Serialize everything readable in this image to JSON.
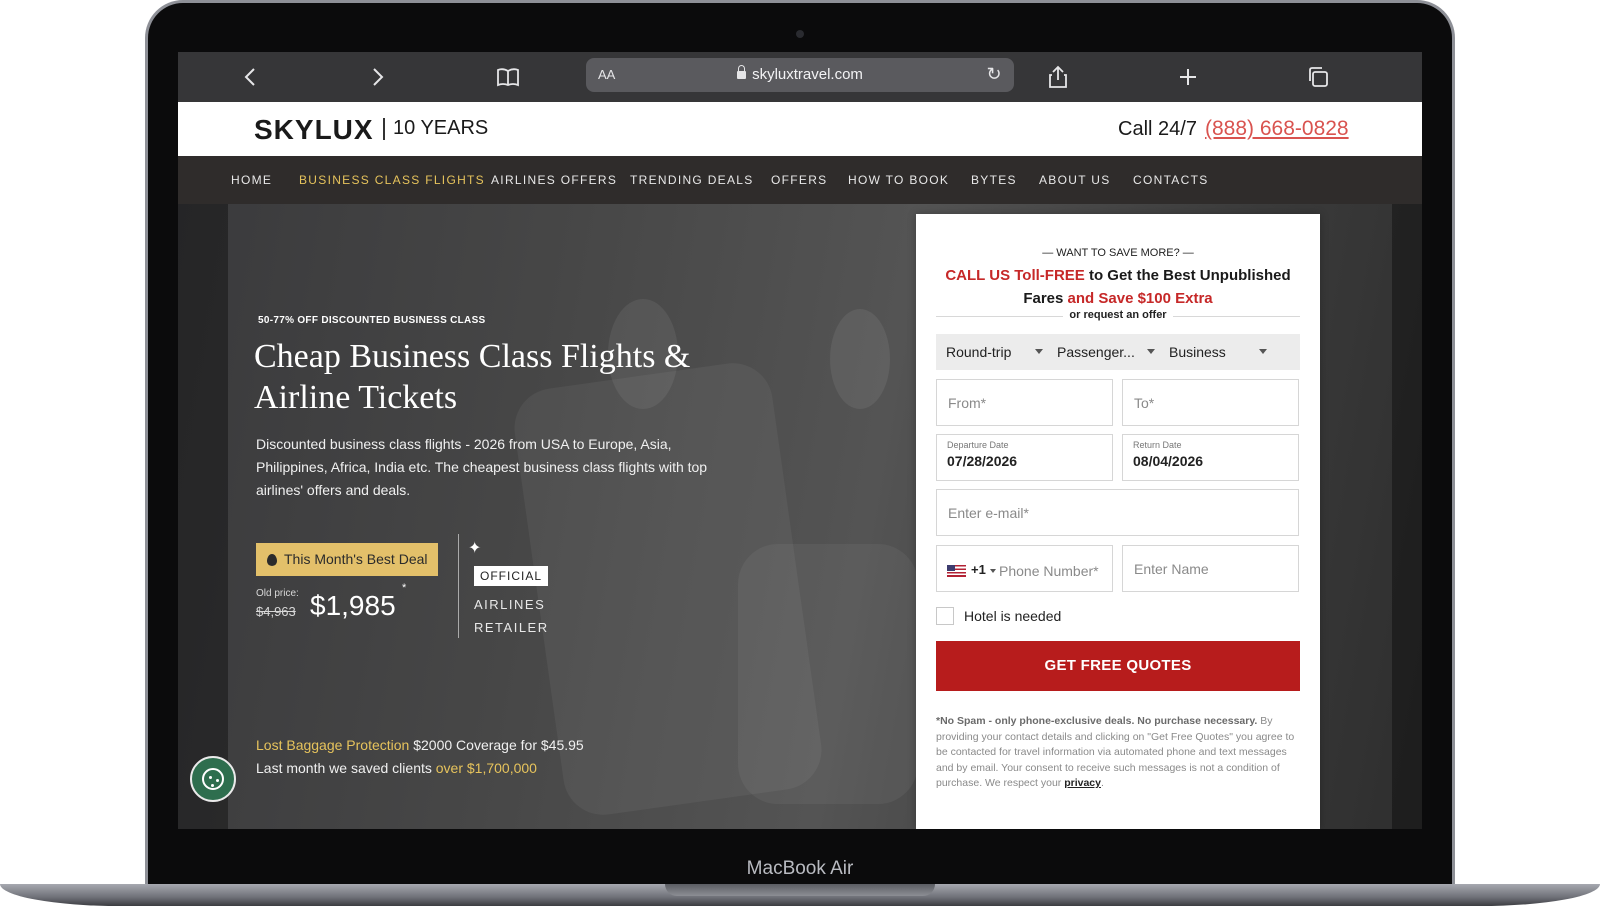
{
  "device": {
    "label": "MacBook Air"
  },
  "browser": {
    "text_size_label": "AA",
    "url": "skyluxtravel.com"
  },
  "header": {
    "logo_text": "SKYLUX",
    "logo_years": "10 YEARS",
    "call_label": "Call 24/7",
    "phone": "(888) 668-0828"
  },
  "nav": {
    "items": [
      {
        "label": "HOME"
      },
      {
        "label": "BUSINESS CLASS FLIGHTS",
        "active": true
      },
      {
        "label": "AIRLINES OFFERS"
      },
      {
        "label": "TRENDING DEALS"
      },
      {
        "label": "OFFERS"
      },
      {
        "label": "HOW TO BOOK"
      },
      {
        "label": "BYTES"
      },
      {
        "label": "ABOUT US"
      },
      {
        "label": "CONTACTS"
      }
    ]
  },
  "hero": {
    "eyebrow": "50-77% OFF DISCOUNTED BUSINESS CLASS",
    "title": "Cheap Business Class Flights & Airline Tickets",
    "description": "Discounted business class flights - 2026 from USA to Europe, Asia, Philippines, Africa, India etc. The cheapest business class flights with top airlines' offers and deals.",
    "deal_badge": "This Month's Best Deal",
    "old_price_label": "Old price:",
    "old_price": "$4,963",
    "new_price": "$1,985",
    "asterisk": "*",
    "official_label": "OFFICIAL",
    "airlines_label": "AIRLINES",
    "retailer_label": "RETAILER",
    "baggage_link": "Lost Baggage Protection",
    "baggage_text": " $2000 Coverage for $45.95",
    "saved_text": "Last month we saved clients ",
    "saved_amount": "over $1,700,000"
  },
  "form": {
    "eyebrow": "— WANT TO SAVE MORE? —",
    "call_red": "CALL US Toll-FREE",
    "call_rest": " to Get the Best Unpublished Fares ",
    "save_red": "and Save $100 Extra",
    "sub": "or request an offer",
    "trip_type": "Round-trip",
    "passengers": "Passenger...",
    "cabin": "Business",
    "from_placeholder": "From*",
    "to_placeholder": "To*",
    "departure_label": "Departure Date",
    "departure_value": "07/28/2026",
    "return_label": "Return Date",
    "return_value": "08/04/2026",
    "email_placeholder": "Enter e-mail*",
    "phone_code": "+1",
    "phone_placeholder": "Phone Number*",
    "name_placeholder": "Enter Name",
    "hotel_label": "Hotel is needed",
    "cta": "GET FREE QUOTES",
    "disclaimer_bold": "*No Spam - only phone-exclusive deals. No purchase necessary.",
    "disclaimer_text": " By providing your contact details and clicking on \"Get Free Quotes\" you agree to be contacted for travel information via automated phone and text messages and by email. Your consent to receive such messages is not a condition of purchase. We respect your ",
    "privacy_link": "privacy",
    "disclaimer_end": "."
  },
  "colors": {
    "accent_gold": "#e6c35c",
    "cta_red": "#b71c1c",
    "phone_red": "#d9534f",
    "nav_bg": "#2f2c2b"
  }
}
